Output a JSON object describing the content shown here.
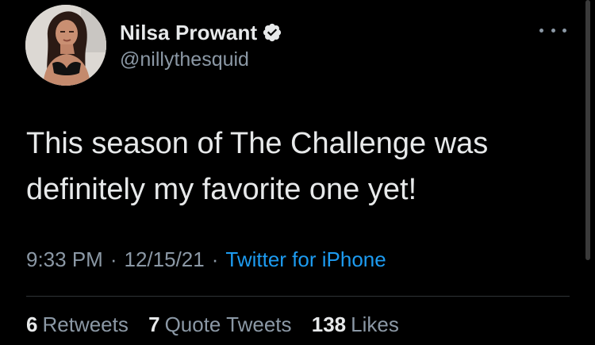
{
  "tweet": {
    "display_name": "Nilsa Prowant",
    "handle": "@nillythesquid",
    "text": "This season of The Challenge was definitely my favorite one yet!",
    "time": "9:33 PM",
    "date": "12/15/21",
    "separator": "·",
    "source": "Twitter for iPhone",
    "stats": {
      "retweets_count": "6",
      "retweets_label": "Retweets",
      "quotes_count": "7",
      "quotes_label": "Quote Tweets",
      "likes_count": "138",
      "likes_label": "Likes"
    }
  },
  "icons": {
    "verified": "verified-badge-icon",
    "more": "more-options-icon"
  },
  "colors": {
    "background": "#000000",
    "primary_text": "#e7e9ea",
    "secondary_text": "#8b98a5",
    "link": "#1d9bf0",
    "divider": "#2f3336"
  }
}
